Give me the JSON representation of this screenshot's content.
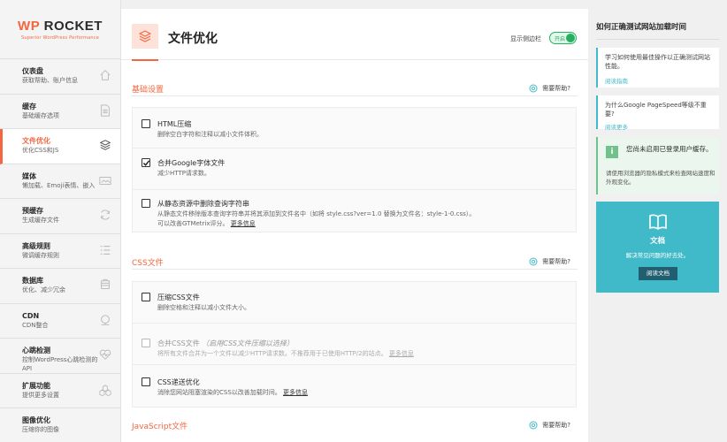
{
  "logo": {
    "wp": "WP",
    "name": "ROCKET",
    "tagline": "Superior WordPress Performance"
  },
  "nav": [
    {
      "title": "仪表盘",
      "sub": "获取帮助、账户信息",
      "icon": "home-icon"
    },
    {
      "title": "缓存",
      "sub": "基础缓存选项",
      "icon": "file-icon"
    },
    {
      "title": "文件优化",
      "sub": "优化CSS和JS",
      "icon": "layers-icon",
      "active": true
    },
    {
      "title": "媒体",
      "sub": "懒加载、Emoji表情、嵌入",
      "icon": "image-icon"
    },
    {
      "title": "预缓存",
      "sub": "生成缓存文件",
      "icon": "refresh-icon"
    },
    {
      "title": "高级规则",
      "sub": "微调缓存规则",
      "icon": "list-icon"
    },
    {
      "title": "数据库",
      "sub": "优化、减少冗余",
      "icon": "database-icon"
    },
    {
      "title": "CDN",
      "sub": "CDN整合",
      "icon": "cdn-icon"
    },
    {
      "title": "心跳检测",
      "sub": "控制WordPress心跳检测的API",
      "icon": "heartbeat-icon"
    },
    {
      "title": "扩展功能",
      "sub": "提供更多设置",
      "icon": "addons-icon"
    },
    {
      "title": "图像优化",
      "sub": "压缩你的图像",
      "icon": "image-opt-icon"
    }
  ],
  "header": {
    "title": "文件优化",
    "sidebar_toggle_label": "显示侧边栏",
    "toggle_text": "开启"
  },
  "sections": {
    "basic": {
      "title": "基础设置",
      "help": "需要帮助?",
      "options": [
        {
          "title": "HTML压缩",
          "desc": "删除空白字符和注释以减小文件体积。",
          "checked": false
        },
        {
          "title": "合并Google字体文件",
          "desc": "减少HTTP请求数。",
          "checked": true
        },
        {
          "title": "从静态资源中删除查询字符串",
          "desc1": "从静态文件移除版本查询字符串并将其添加到文件名中（如将 style.css?ver=1.0 替换为文件名：style-1-0.css）。",
          "desc2": "可以改善GTMetrix评分。",
          "more": "更多信息",
          "checked": false
        }
      ]
    },
    "css": {
      "title": "CSS文件",
      "help": "需要帮助?",
      "options": [
        {
          "title": "压缩CSS文件",
          "desc": "删除空格和注释以减小文件大小。",
          "checked": false
        },
        {
          "title": "合并CSS文件",
          "note": "（启用CSS文件压缩以选择）",
          "desc": "将所有文件合并为一个文件以减少HTTP请求数。不推荐用于已使用HTTP/2的站点。",
          "more": "更多信息",
          "checked": false,
          "disabled": true
        },
        {
          "title": "CSS递送优化",
          "desc": "消除您网站阻塞渲染的CSS以改善加载时间。",
          "more": "更多信息",
          "checked": false
        }
      ]
    },
    "js": {
      "title": "JavaScript文件",
      "help": "需要帮助?"
    }
  },
  "right": {
    "title": "如何正确测试网站加载时间",
    "tips": [
      {
        "text": "学习如何使用最佳操作以正确测试网站性能。",
        "link": "阅读指南"
      },
      {
        "text": "为什么Google PageSpeed等级不重要?",
        "link": "阅读更多"
      }
    ],
    "notice": {
      "badge": "i",
      "title": "您尚未启用已登录用户缓存。",
      "desc": "请使用浏览器的隐私模式来检查网站速度和外观变化。"
    },
    "doc": {
      "title": "文档",
      "desc": "解决常见问题的好去处。",
      "button": "阅读文档"
    }
  },
  "colors": {
    "accent": "#f56640",
    "teal": "#40bac8",
    "green": "#27ae60"
  }
}
